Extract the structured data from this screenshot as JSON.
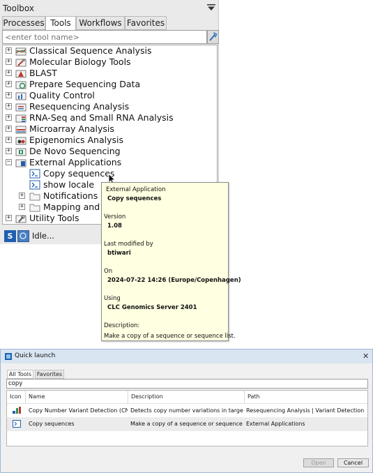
{
  "toolbox": {
    "title": "Toolbox",
    "tabs": [
      "Processes",
      "Tools",
      "Workflows",
      "Favorites"
    ],
    "active_tab": "Tools",
    "search_placeholder": "<enter tool name>",
    "tree": [
      {
        "label": "Classical Sequence Analysis",
        "expander": "+"
      },
      {
        "label": "Molecular Biology Tools",
        "expander": "+"
      },
      {
        "label": "BLAST",
        "expander": "+"
      },
      {
        "label": "Prepare Sequencing Data",
        "expander": "+"
      },
      {
        "label": "Quality Control",
        "expander": "+"
      },
      {
        "label": "Resequencing Analysis",
        "expander": "+"
      },
      {
        "label": "RNA-Seq and Small RNA Analysis",
        "expander": "+"
      },
      {
        "label": "Microarray Analysis",
        "expander": "+"
      },
      {
        "label": "Epigenomics Analysis",
        "expander": "+"
      },
      {
        "label": "De Novo Sequencing",
        "expander": "+"
      },
      {
        "label": "External Applications",
        "expander": "−"
      },
      {
        "label": "Copy sequences"
      },
      {
        "label": "show locale"
      },
      {
        "label": "Notifications",
        "expander": "+"
      },
      {
        "label": "Mapping and",
        "expander": "+"
      },
      {
        "label": "Utility Tools",
        "expander": "+"
      }
    ],
    "status": {
      "text": "Idle..."
    },
    "colors": {
      "accent": "#1f5fae"
    }
  },
  "tooltip": {
    "type_label": "External Application",
    "name": "Copy sequences",
    "version_label": "Version",
    "version": "1.08",
    "modified_label": "Last modified by",
    "modified_by": "btiwari",
    "on_label": "On",
    "on": "2024-07-22 14:26 (Europe/Copenhagen)",
    "using_label": "Using",
    "using": "CLC Genomics Server 2401",
    "description_label": "Description:",
    "description": "Make a copy of a sequence or sequence list."
  },
  "quick_launch": {
    "title": "Quick launch",
    "tabs": [
      "All Tools",
      "Favorites"
    ],
    "search_value": "copy",
    "columns": [
      "Icon",
      "Name",
      "Description",
      "Path"
    ],
    "rows": [
      {
        "icon": "cnv-icon",
        "name": "Copy Number Variant Detection (CNVs)",
        "description": "Detects copy number variations in targeted ...",
        "path": "Resequencing Analysis | Variant Detection"
      },
      {
        "icon": "external-app-icon",
        "name": "Copy sequences",
        "description": "Make a copy of a sequence or sequence list.",
        "path": "External Applications"
      }
    ],
    "buttons": {
      "open": "Open",
      "cancel": "Cancel"
    }
  }
}
